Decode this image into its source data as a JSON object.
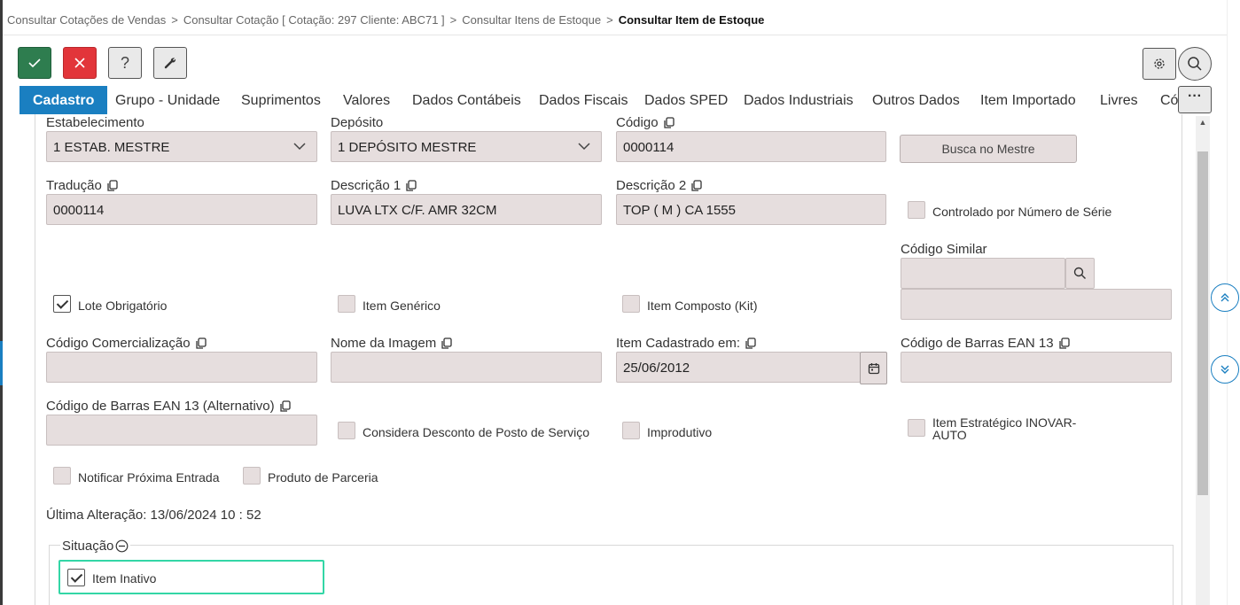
{
  "breadcrumb": {
    "item1": "Consultar Cotações de Vendas",
    "item2": "Consultar Cotação [ Cotação: 297 Cliente: ABC71 ]",
    "item3": "Consultar Itens de Estoque",
    "current": "Consultar Item de Estoque",
    "separator": ">"
  },
  "toolbar": {
    "help_label": "?",
    "more_label": "···"
  },
  "tabs": [
    "Cadastro",
    "Grupo - Unidade",
    "Suprimentos",
    "Valores",
    "Dados Contábeis",
    "Dados Fiscais",
    "Dados SPED",
    "Dados Industriais",
    "Outros Dados",
    "Item Importado",
    "Livres",
    "Có"
  ],
  "form": {
    "estabelecimento": {
      "label": "Estabelecimento",
      "value": "1 ESTAB. MESTRE"
    },
    "deposito": {
      "label": "Depósito",
      "value": "1 DEPÓSITO MESTRE"
    },
    "codigo": {
      "label": "Código",
      "value": "0000114"
    },
    "busca_button": "Busca no Mestre",
    "traducao": {
      "label": "Tradução",
      "value": "0000114"
    },
    "descricao1": {
      "label": "Descrição 1",
      "value": "LUVA LTX C/F. AMR 32CM"
    },
    "descricao2": {
      "label": "Descrição 2",
      "value": "TOP ( M ) CA 1555"
    },
    "controlado_serie": {
      "label": "Controlado por Número de Série",
      "checked": false
    },
    "codigo_similar": {
      "label": "Código Similar",
      "value": "",
      "description": ""
    },
    "lote_obrigatorio": {
      "label": "Lote Obrigatório",
      "checked": true
    },
    "item_generico": {
      "label": "Item Genérico",
      "checked": false
    },
    "item_composto": {
      "label": "Item Composto (Kit)",
      "checked": false
    },
    "codigo_comercializacao": {
      "label": "Código Comercialização",
      "value": ""
    },
    "nome_imagem": {
      "label": "Nome da Imagem",
      "value": ""
    },
    "item_cadastrado": {
      "label": "Item Cadastrado em:",
      "value": "25/06/2012"
    },
    "ean13": {
      "label": "Código de Barras EAN 13",
      "value": ""
    },
    "ean13_alt": {
      "label": "Código de Barras EAN 13 (Alternativo)",
      "value": ""
    },
    "desconto_posto": {
      "label": "Considera Desconto de Posto de Serviço",
      "checked": false
    },
    "improdutivo": {
      "label": "Improdutivo",
      "checked": false
    },
    "inovar_auto": {
      "label_line1": "Item Estratégico INOVAR-",
      "label_line2": "AUTO",
      "checked": false
    },
    "notificar_entrada": {
      "label": "Notificar Próxima Entrada",
      "checked": false
    },
    "produto_parceria": {
      "label": "Produto de Parceria",
      "checked": false
    },
    "ultima_alteracao": "Última Alteração: 13/06/2024 10 : 52",
    "situacao": {
      "legend": "Situação",
      "item_inativo": {
        "label": "Item Inativo",
        "checked": true
      }
    }
  },
  "colors": {
    "accent": "#1a7fc1",
    "confirm": "#2e7d4f",
    "cancel": "#e2353a",
    "field_bg": "#e6dede",
    "focus": "#33d6a6"
  },
  "icons": [
    "check-icon",
    "close-icon",
    "help-icon",
    "wrench-icon",
    "gear-icon",
    "search-icon",
    "more-icon",
    "chevron-down-icon",
    "copy-icon",
    "calendar-icon",
    "scroll-up-icon",
    "scroll-down-icon",
    "collapse-icon"
  ]
}
